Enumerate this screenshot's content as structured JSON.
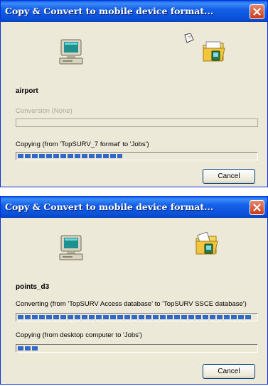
{
  "dialogs": [
    {
      "title": "Copy & Convert to mobile device format...",
      "item_name": "airport",
      "step1": {
        "label": "Conversion (None)",
        "enabled": false,
        "progress": 0.0
      },
      "step2": {
        "label": "Copying (from 'TopSURV_7 format' to 'Jobs')",
        "enabled": true,
        "progress": 0.44
      },
      "cancel_label": "Cancel"
    },
    {
      "title": "Copy & Convert to mobile device format...",
      "item_name": "points_d3",
      "step1": {
        "label": "Converting (from 'TopSURV Access database' to 'TopSURV SSCE database')",
        "enabled": true,
        "progress": 1.0
      },
      "step2": {
        "label": "Copying (from desktop computer to 'Jobs')",
        "enabled": true,
        "progress": 0.1
      },
      "cancel_label": "Cancel"
    }
  ],
  "icons": {
    "source": "desktop-computer-icon",
    "destination": "pocket-pc-folder-icon",
    "in_transit": "document-icon"
  },
  "colors": {
    "progress_segment": "#3169c6",
    "title_bar": "#0a4fd8",
    "close_button": "#c8391c"
  }
}
